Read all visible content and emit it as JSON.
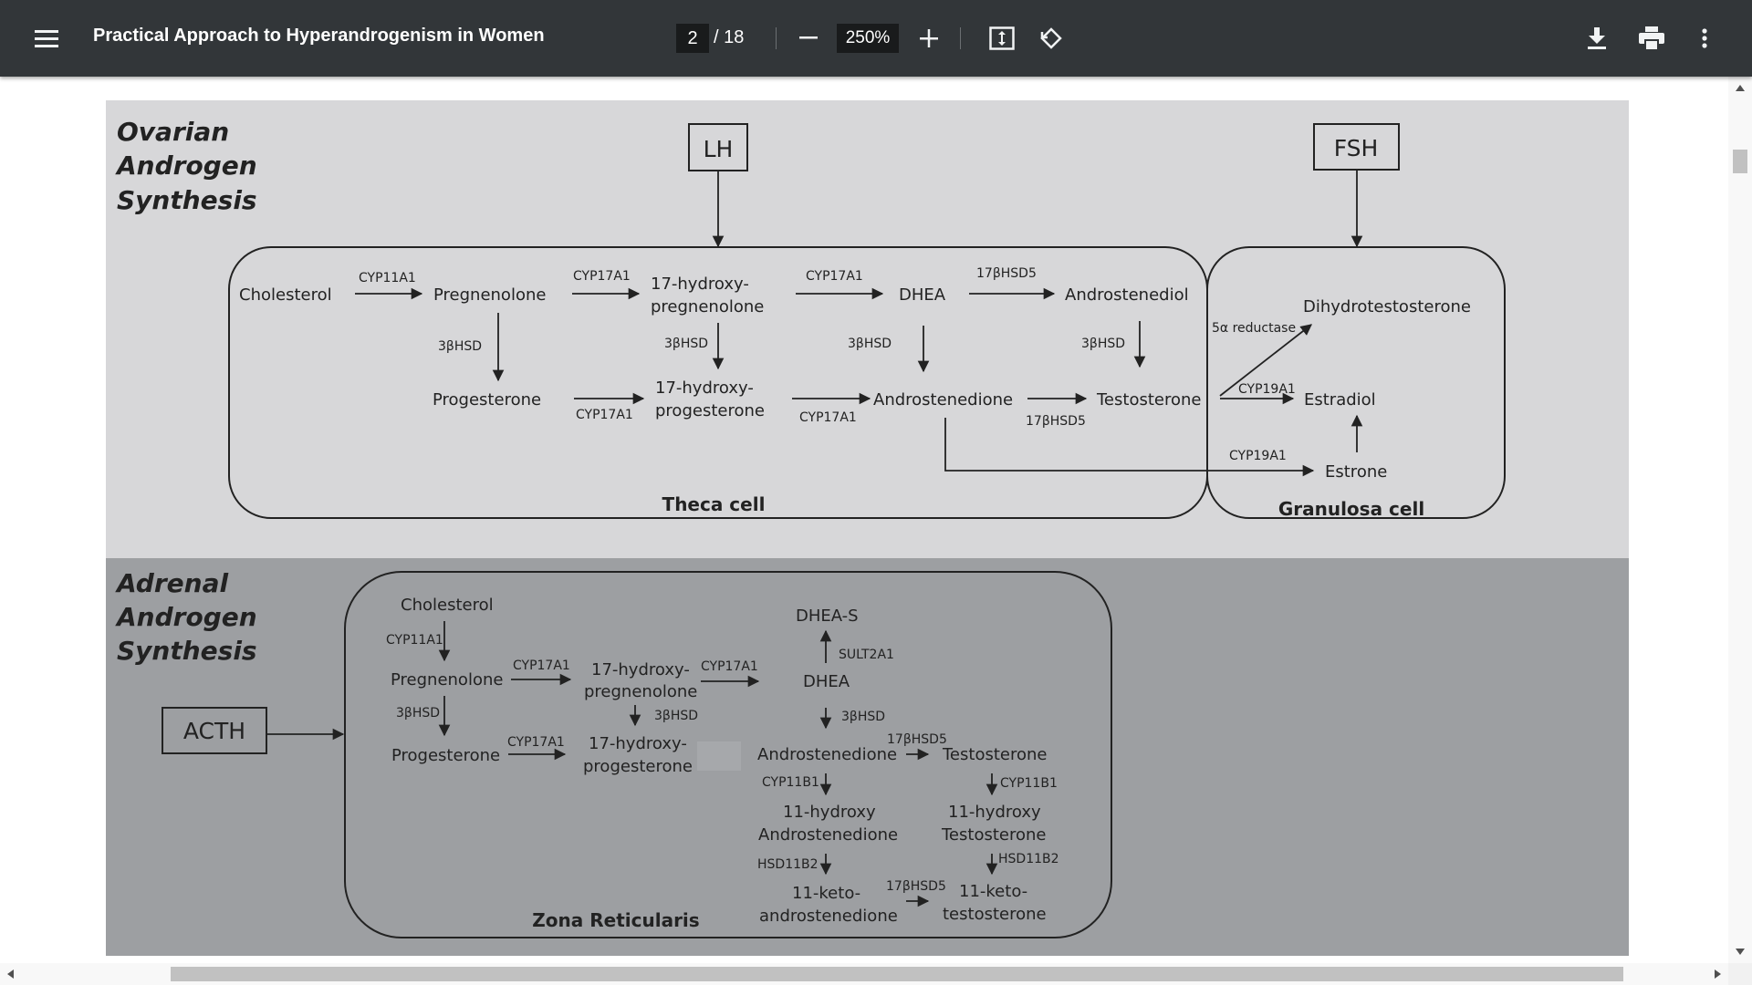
{
  "toolbar": {
    "menu_icon": "hamburger-menu-icon",
    "title": "Practical Approach to Hyperandrogenism in Women",
    "current_page": "2",
    "total_pages": "/ 18",
    "zoom": "250%",
    "icons": [
      "minus-icon",
      "plus-icon",
      "fit-page-icon",
      "rotate-icon",
      "download-icon",
      "print-icon",
      "more-vert-icon"
    ]
  },
  "colors": {
    "toolbar_bg": "#323639",
    "ovarian_panel_bg": "#d7d7d9",
    "adrenal_panel_bg": "#9d9fa2"
  },
  "ovarian": {
    "title_lines": [
      "Ovarian",
      "Androgen",
      "Synthesis"
    ],
    "lh": "LH",
    "fsh": "FSH",
    "theca_label": "Theca cell",
    "granulosa_label": "Granulosa cell",
    "cholesterol": "Cholesterol",
    "cyp11a1": "CYP11A1",
    "pregnenolone": "Pregnenolone",
    "cyp17a1": "CYP17A1",
    "oh_preg_line1": "17-hydroxy-",
    "oh_preg_line2": "pregnenolone",
    "dhea": "DHEA",
    "hsd17b5": "17βHSD5",
    "androstenediol": "Androstenediol",
    "hsd3b": "3βHSD",
    "progesterone": "Progesterone",
    "oh_prog_line1": "17-hydroxy-",
    "oh_prog_line2": "progesterone",
    "androstenedione": "Androstenedione",
    "testosterone": "Testosterone",
    "dht": "Dihydrotestosterone",
    "reductase": "5α reductase",
    "cyp19a1": "CYP19A1",
    "estradiol": "Estradiol",
    "estrone": "Estrone"
  },
  "adrenal": {
    "title_lines": [
      "Adrenal",
      "Androgen",
      "Synthesis"
    ],
    "acth": "ACTH",
    "zona_label": "Zona Reticularis",
    "cholesterol": "Cholesterol",
    "cyp11a1": "CYP11A1",
    "pregnenolone": "Pregnenolone",
    "hsd3b": "3βHSD",
    "progesterone": "Progesterone",
    "cyp17a1": "CYP17A1",
    "oh_preg_line1": "17-hydroxy-",
    "oh_preg_line2": "pregnenolone",
    "oh_prog_line1": "17-hydroxy-",
    "oh_prog_line2": "progesterone",
    "dheas": "DHEA-S",
    "sult2a1": "SULT2A1",
    "dhea": "DHEA",
    "androstenedione": "Androstenedione",
    "hsd17b5": "17βHSD5",
    "testosterone": "Testosterone",
    "cyp11b1": "CYP11B1",
    "oh_andro_line1": "11-hydroxy",
    "oh_andro_line2": "Androstenedione",
    "oh_testo_line1": "11-hydroxy",
    "oh_testo_line2": "Testosterone",
    "hsd11b2": "HSD11B2",
    "keto_andro_line1": "11-keto-",
    "keto_andro_line2": "androstenedione",
    "keto_testo_line1": "11-keto-",
    "keto_testo_line2": "testosterone"
  }
}
